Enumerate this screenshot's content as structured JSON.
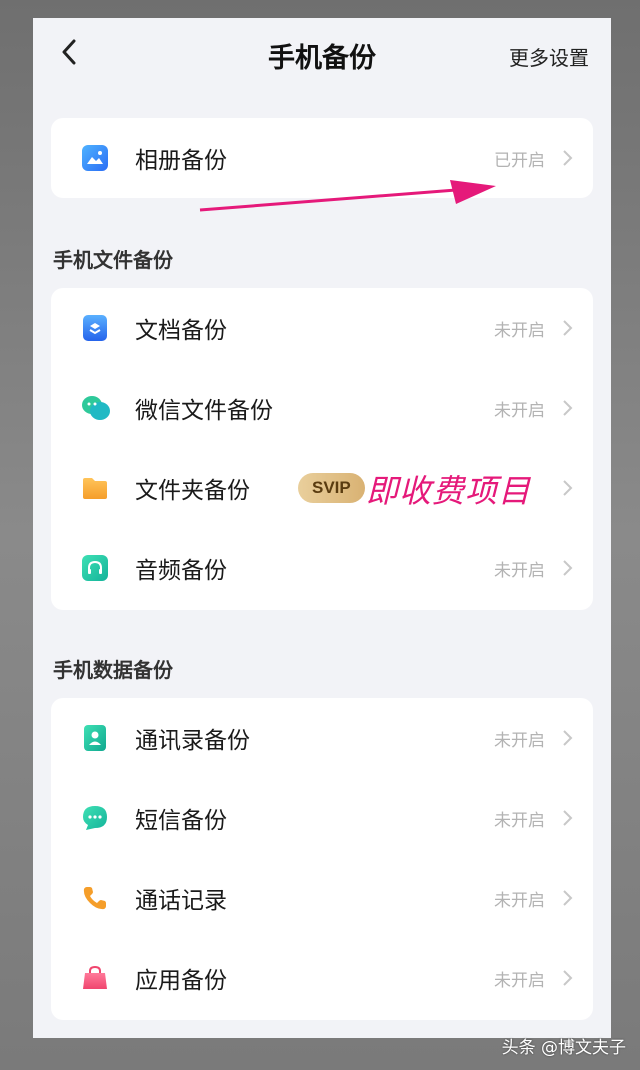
{
  "header": {
    "title": "手机备份",
    "more_label": "更多设置"
  },
  "album": {
    "label": "相册备份",
    "status": "已开启"
  },
  "file_section": {
    "title": "手机文件备份",
    "items": [
      {
        "label": "文档备份",
        "status": "未开启",
        "icon": "document-icon"
      },
      {
        "label": "微信文件备份",
        "status": "未开启",
        "icon": "wechat-icon"
      },
      {
        "label": "文件夹备份",
        "status": "",
        "icon": "folder-icon",
        "badge": "SVIP",
        "annotation": "即收费项目"
      },
      {
        "label": "音频备份",
        "status": "未开启",
        "icon": "headphone-icon"
      }
    ]
  },
  "data_section": {
    "title": "手机数据备份",
    "items": [
      {
        "label": "通讯录备份",
        "status": "未开启",
        "icon": "contact-icon"
      },
      {
        "label": "短信备份",
        "status": "未开启",
        "icon": "sms-icon"
      },
      {
        "label": "通话记录",
        "status": "未开启",
        "icon": "phone-icon"
      },
      {
        "label": "应用备份",
        "status": "未开启",
        "icon": "app-bag-icon"
      }
    ]
  },
  "watermark": "头条 @博文夫子",
  "colors": {
    "background": "#f2f3f7",
    "annotation": "#e5197a",
    "status": "#b3b3b3",
    "svip_gold": "#dcb87c"
  }
}
